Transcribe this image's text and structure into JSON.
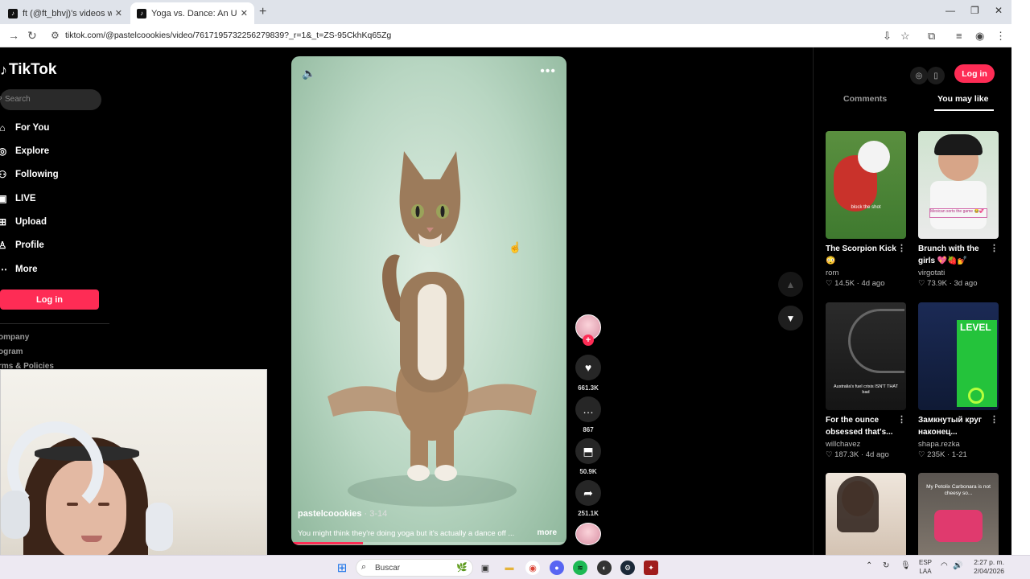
{
  "browser": {
    "tabs": [
      {
        "title": "ft (@ft_bhvj)'s videos with som",
        "favicon": "tiktok-icon",
        "active": false
      },
      {
        "title": "Yoga vs. Dance: An Unexpected",
        "favicon": "tiktok-icon",
        "active": true
      }
    ],
    "url": "tiktok.com/@pastelcoookies/video/7617195732256279839?_r=1&_t=ZS-95CkhKq65Zg"
  },
  "tiktok": {
    "logo": "TikTok",
    "search_placeholder": "Search",
    "nav": [
      {
        "label": "For You",
        "icon": "home-icon"
      },
      {
        "label": "Explore",
        "icon": "compass-icon"
      },
      {
        "label": "Following",
        "icon": "following-icon"
      },
      {
        "label": "LIVE",
        "icon": "live-icon"
      },
      {
        "label": "Upload",
        "icon": "upload-icon"
      },
      {
        "label": "Profile",
        "icon": "profile-icon"
      },
      {
        "label": "More",
        "icon": "more-icon"
      }
    ],
    "login_label": "Log in",
    "footer_links": [
      "ompany",
      "ogram",
      "rms & Policies"
    ]
  },
  "video": {
    "username": "pastelcoookies",
    "date": " · 3-14",
    "caption": "You might think they're doing yoga but it's actually a dance off ...",
    "more_label": "more",
    "progress": 0.26,
    "actions": {
      "likes": "661.3K",
      "comments": "867",
      "saves": "50.9K",
      "shares": "251.1K"
    }
  },
  "right_panel": {
    "login_label": "Log in",
    "tabs": [
      "Comments",
      "You may like"
    ],
    "active_tab": "You may like",
    "cards": [
      {
        "title": "The Scorpion Kick 😳",
        "author": "rom",
        "likes": "14.5K",
        "age": "4d ago",
        "thumb_text": "block the shot"
      },
      {
        "title": "Brunch with the girls 💖🍓💅",
        "author": "virgotati",
        "likes": "73.9K",
        "age": "3d ago",
        "thumb_text": "Mexican sorts the game 😂💞"
      },
      {
        "title": "For the ounce obsessed that's...",
        "author": "willchavez",
        "likes": "187.3K",
        "age": "4d ago",
        "thumb_text": "Australia's fuel crisis ISN'T THAT bad"
      },
      {
        "title": "Замкнутый круг наконец...",
        "author": "shapa.rezka",
        "likes": "235K",
        "age": "1-21",
        "thumb_text": "LEVEL"
      },
      {
        "title": "",
        "author": "",
        "likes": "",
        "age": "",
        "thumb_text": ""
      },
      {
        "title": "",
        "author": "",
        "likes": "",
        "age": "",
        "thumb_text": "My Petolix Carbonara is not cheesy so..."
      }
    ]
  },
  "taskbar": {
    "search_label": "Buscar",
    "lang_top": "ESP",
    "lang_bottom": "LAA",
    "time": "2:27 p. m.",
    "date": "2/04/2026"
  }
}
